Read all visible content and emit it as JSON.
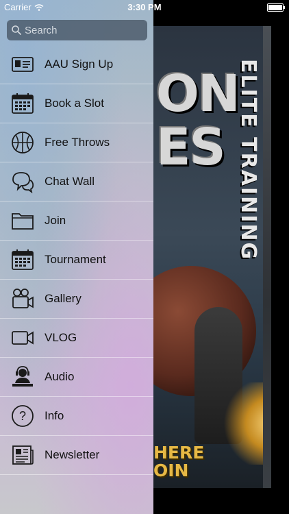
{
  "status_bar": {
    "carrier": "Carrier",
    "time": "3:30 PM"
  },
  "search": {
    "placeholder": "Search"
  },
  "menu": {
    "items": [
      {
        "label": "AAU Sign Up",
        "icon": "id-card-icon"
      },
      {
        "label": "Book a Slot",
        "icon": "calendar-icon"
      },
      {
        "label": "Free Throws",
        "icon": "basketball-icon"
      },
      {
        "label": "Chat Wall",
        "icon": "chat-bubbles-icon"
      },
      {
        "label": "Join",
        "icon": "folder-icon"
      },
      {
        "label": "Tournament",
        "icon": "calendar-icon"
      },
      {
        "label": "Gallery",
        "icon": "video-camera-icon"
      },
      {
        "label": "VLOG",
        "icon": "camcorder-icon"
      },
      {
        "label": "Audio",
        "icon": "headset-user-icon"
      },
      {
        "label": "Info",
        "icon": "question-icon"
      },
      {
        "label": "Newsletter",
        "icon": "newspaper-icon"
      }
    ]
  },
  "poster": {
    "title_letters": "ON\nES",
    "vertical_text": "ELITE TRAINING",
    "cta": "HERE\nOIN"
  }
}
